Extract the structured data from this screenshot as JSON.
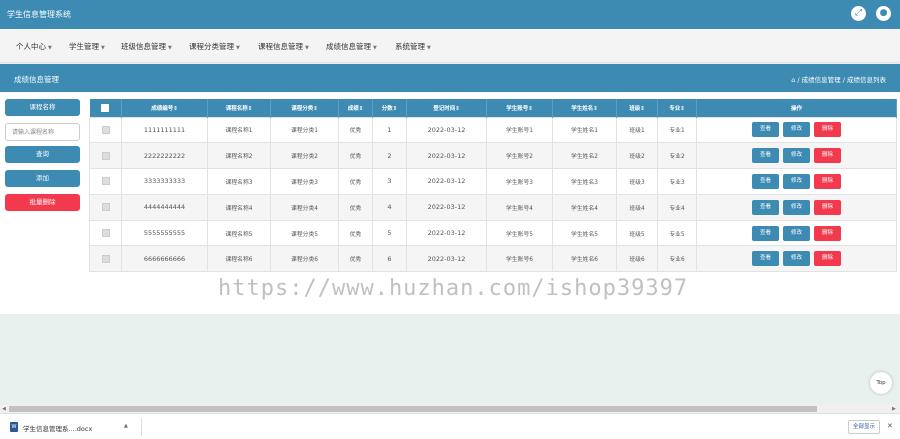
{
  "app": {
    "title": "学生信息管理系统"
  },
  "topbar_icons": [
    "fullscreen-icon",
    "user-avatar-icon"
  ],
  "nav": [
    {
      "label": "个人中心"
    },
    {
      "label": "学生管理"
    },
    {
      "label": "班级信息管理"
    },
    {
      "label": "课程分类管理"
    },
    {
      "label": "课程信息管理"
    },
    {
      "label": "成绩信息管理"
    },
    {
      "label": "系统管理"
    }
  ],
  "section": {
    "title": "成绩信息管理",
    "breadcrumb": [
      "成绩信息管理",
      "成绩信息列表"
    ],
    "breadcrumb_sep": " / "
  },
  "sidebar": {
    "label": "课程名称",
    "search_placeholder": "请输入课程名称",
    "search_button": "查询",
    "add_button": "添加",
    "batch_delete_button": "批量删除"
  },
  "table": {
    "columns": [
      "成绩编号",
      "课程名称",
      "课程分类",
      "成绩",
      "分数",
      "登记时间",
      "学生账号",
      "学生姓名",
      "班级",
      "专业",
      "操作"
    ],
    "sort_mark": "⇕",
    "actions": {
      "view": "查看",
      "edit": "修改",
      "delete": "删除"
    },
    "rows": [
      [
        "1111111111",
        "课程名称1",
        "课程分类1",
        "优秀",
        "1",
        "2022-03-12",
        "学生账号1",
        "学生姓名1",
        "班级1",
        "专业1"
      ],
      [
        "2222222222",
        "课程名称2",
        "课程分类2",
        "优秀",
        "2",
        "2022-03-12",
        "学生账号2",
        "学生姓名2",
        "班级2",
        "专业2"
      ],
      [
        "3333333333",
        "课程名称3",
        "课程分类3",
        "优秀",
        "3",
        "2022-03-12",
        "学生账号3",
        "学生姓名3",
        "班级3",
        "专业3"
      ],
      [
        "4444444444",
        "课程名称4",
        "课程分类4",
        "优秀",
        "4",
        "2022-03-12",
        "学生账号4",
        "学生姓名4",
        "班级4",
        "专业4"
      ],
      [
        "5555555555",
        "课程名称5",
        "课程分类5",
        "优秀",
        "5",
        "2022-03-12",
        "学生账号5",
        "学生姓名5",
        "班级5",
        "专业5"
      ],
      [
        "6666666666",
        "课程名称6",
        "课程分类6",
        "优秀",
        "6",
        "2022-03-12",
        "学生账号6",
        "学生姓名6",
        "班级6",
        "专业6"
      ]
    ]
  },
  "watermark": "https://www.huzhan.com/ishop39397",
  "back_to_top": "Top",
  "download_bar": {
    "file_name": "学生信息管理系....docx",
    "show_all": "全部显示"
  },
  "colors": {
    "primary": "#3d8ab3",
    "danger": "#f2394e",
    "page_bg": "#e9f1ee"
  }
}
